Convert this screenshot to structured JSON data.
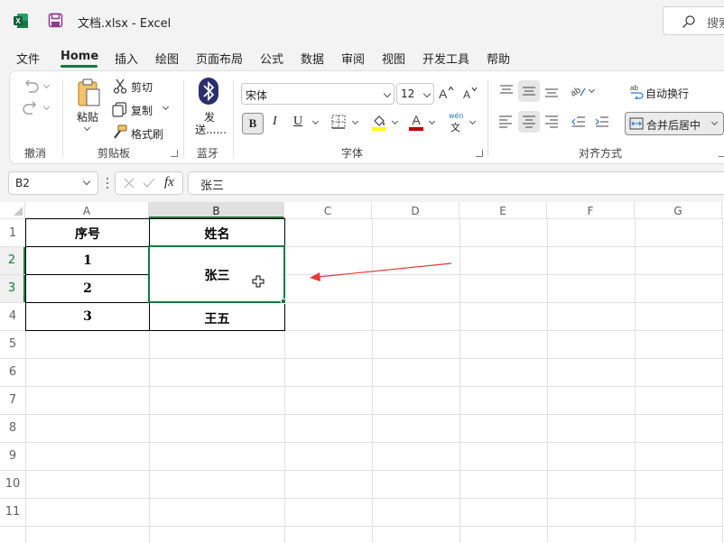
{
  "titlebar": {
    "doc_title": "文档.xlsx  -  Excel",
    "search_text": "搜索"
  },
  "tabs": [
    "文件",
    "Home",
    "插入",
    "绘图",
    "页面布局",
    "公式",
    "数据",
    "审阅",
    "视图",
    "开发工具",
    "帮助"
  ],
  "ribbon": {
    "undo_group": "撤消",
    "clipboard": {
      "paste": "粘贴",
      "cut": "剪切",
      "copy": "复制",
      "format_painter": "格式刷",
      "label": "剪贴板"
    },
    "bluetooth": {
      "send1": "发",
      "send2": "送......",
      "label": "蓝牙"
    },
    "font": {
      "name": "宋体",
      "size": "12",
      "label": "字体",
      "italic": "I",
      "underline": "U",
      "bold": "B",
      "wen": "wén",
      "wen2": "文"
    },
    "alignment": {
      "wrap_text": "自动换行",
      "merge_center": "合并后居中",
      "label": "对齐方式"
    }
  },
  "formula_bar": {
    "name_box": "B2",
    "fx": "fx",
    "formula": "张三"
  },
  "sheet": {
    "columns": [
      "A",
      "B",
      "C",
      "D",
      "E",
      "F",
      "G"
    ],
    "rows": [
      "1",
      "2",
      "3",
      "4",
      "5",
      "6",
      "7",
      "8",
      "9",
      "10",
      "11"
    ],
    "cells": {
      "A1": "序号",
      "B1": "姓名",
      "A2": "1",
      "A3": "2",
      "A4": "3",
      "B2": "张三",
      "B4": "王五"
    }
  },
  "colors": {
    "excel_green": "#107c41",
    "annotation_red": "#e53935",
    "font_color": "#c00000",
    "highlight": "#ffff00"
  }
}
